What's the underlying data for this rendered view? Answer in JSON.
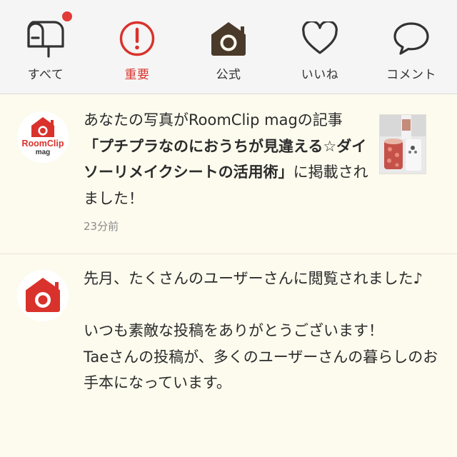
{
  "tabs": [
    {
      "label": "すべて",
      "icon": "mailbox-icon",
      "active": false,
      "has_badge": true
    },
    {
      "label": "重要",
      "icon": "exclamation-circle-icon",
      "active": true,
      "has_badge": false
    },
    {
      "label": "公式",
      "icon": "house-camera-icon",
      "active": false,
      "has_badge": false
    },
    {
      "label": "いいね",
      "icon": "heart-icon",
      "active": false,
      "has_badge": false
    },
    {
      "label": "コメント",
      "icon": "speech-bubble-icon",
      "active": false,
      "has_badge": false
    }
  ],
  "notifications": [
    {
      "avatar_text": "RoomClip mag",
      "avatar_brand_1": "RoomClip",
      "avatar_brand_2": "mag",
      "text_before": "あなたの写真がRoomClip magの記事",
      "text_bold": "「プチプラなのにおうちが見違える☆ダイソーリメイクシートの活用術」",
      "text_after": "に掲載されました！",
      "time": "23分前"
    },
    {
      "line1": "先月、たくさんのユーザーさんに閲覧されました♪",
      "line2": "いつも素敵な投稿をありがとうございます！",
      "line3": "Taeさんの投稿が、多くのユーザーさんの暮らしのお手本になっています。"
    }
  ],
  "colors": {
    "accent": "#d9322c",
    "background": "#fdfbee",
    "tabbar": "#f5f5f5",
    "icon_dark": "#4a3a2a"
  }
}
